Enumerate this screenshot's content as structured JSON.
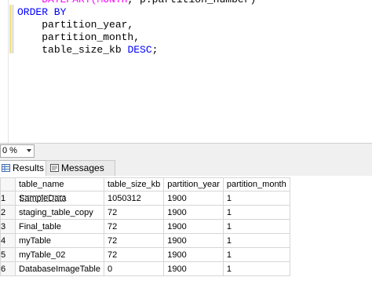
{
  "editor": {
    "lines": [
      {
        "indent": "    ",
        "parts": [
          {
            "text": "DATEPART(",
            "cls": "fn"
          },
          {
            "text": "MONTH",
            "cls": "fn"
          },
          {
            "text": ", p.partition_number)",
            "cls": ""
          }
        ]
      },
      {
        "indent": "",
        "parts": [
          {
            "text": "ORDER BY",
            "cls": "kw"
          }
        ]
      },
      {
        "indent": "    ",
        "parts": [
          {
            "text": "partition_year,",
            "cls": ""
          }
        ]
      },
      {
        "indent": "    ",
        "parts": [
          {
            "text": "partition_month,",
            "cls": ""
          }
        ]
      },
      {
        "indent": "    ",
        "parts": [
          {
            "text": "table_size_kb ",
            "cls": ""
          },
          {
            "text": "DESC",
            "cls": "kw"
          },
          {
            "text": ";",
            "cls": ""
          }
        ]
      }
    ]
  },
  "zoom": {
    "value": "0 %"
  },
  "tabs": {
    "results_label": "Results",
    "messages_label": "Messages"
  },
  "grid": {
    "columns": [
      "table_name",
      "table_size_kb",
      "partition_year",
      "partition_month"
    ],
    "rows": [
      {
        "num": "1",
        "cells": [
          "SampleData",
          "1050312",
          "1900",
          "1"
        ]
      },
      {
        "num": "2",
        "cells": [
          "staging_table_copy",
          "72",
          "1900",
          "1"
        ]
      },
      {
        "num": "3",
        "cells": [
          "Final_table",
          "72",
          "1900",
          "1"
        ]
      },
      {
        "num": "4",
        "cells": [
          "myTable",
          "72",
          "1900",
          "1"
        ]
      },
      {
        "num": "5",
        "cells": [
          "myTable_02",
          "72",
          "1900",
          "1"
        ]
      },
      {
        "num": "6",
        "cells": [
          "DatabaseImageTable",
          "0",
          "1900",
          "1"
        ]
      }
    ]
  }
}
